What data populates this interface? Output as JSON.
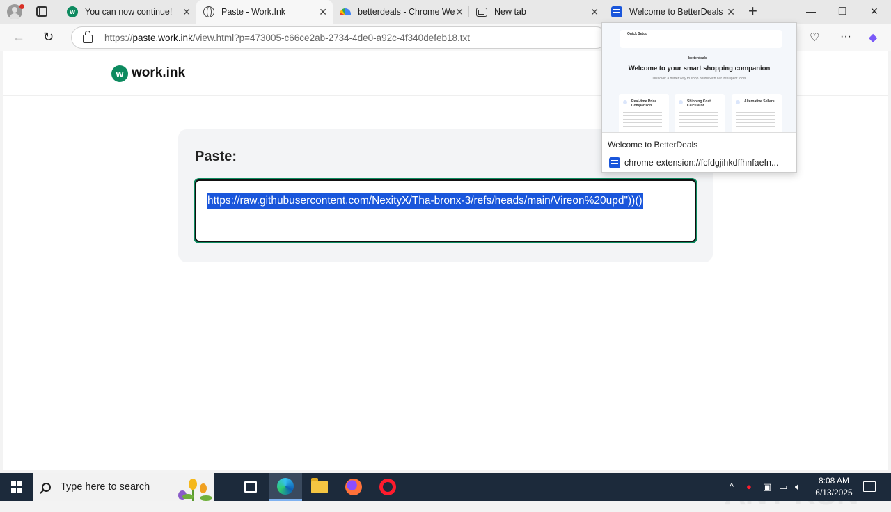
{
  "browser": {
    "tabs": [
      {
        "label": "You can now continue!",
        "icon": "workink-favicon-icon",
        "active": false
      },
      {
        "label": "Paste - Work.Ink",
        "icon": "globe-icon",
        "active": true
      },
      {
        "label": "betterdeals - Chrome We",
        "icon": "chrome-webstore-icon",
        "active": false
      },
      {
        "label": "New tab",
        "icon": "new-tab-icon",
        "active": false
      },
      {
        "label": "Welcome to BetterDeals",
        "icon": "betterdeals-icon",
        "active": false
      }
    ],
    "address": {
      "prefix": "https://",
      "host": "paste.work.ink",
      "path": "/view.html?p=473005-c66ce2ab-2734-4de0-a92c-4f340defeb18.txt"
    }
  },
  "page": {
    "logo_mark": "w",
    "logo_text": "work.ink",
    "card_title": "Paste:",
    "paste_content": "https://raw.githubusercontent.com/NexityX/Tha-bronx-3/refs/heads/main/Vireon%20upd\"))()"
  },
  "tab_popup": {
    "preview": {
      "setup_label": "Quick Setup",
      "brand": "betterdeals",
      "title": "Welcome to your smart shopping companion",
      "subtitle": "Discover a better way to shop online with our intelligent tools",
      "cards": [
        {
          "title": "Real-time Price Comparison"
        },
        {
          "title": "Shipping Cost Calculator"
        },
        {
          "title": "Alternative Sellers"
        }
      ]
    },
    "title": "Welcome to BetterDeals",
    "url": "chrome-extension://fcfdgjihkdffhnfaefn..."
  },
  "watermark": "ANY RUN",
  "taskbar": {
    "search_placeholder": "Type here to search",
    "time": "8:08 AM",
    "date": "6/13/2025"
  },
  "colors": {
    "brand_green": "#0d8a5f",
    "selection_blue": "#1a56db",
    "taskbar_bg": "#1c2a3b"
  }
}
